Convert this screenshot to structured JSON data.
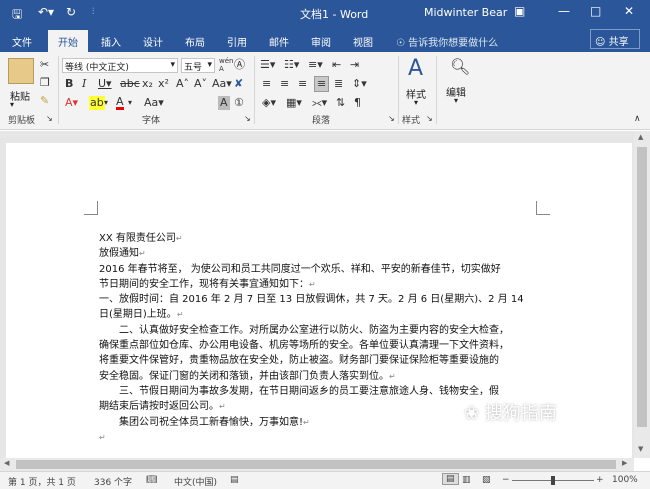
{
  "window": {
    "title": "文档1 - Word",
    "user": "Midwinter Bear"
  },
  "tabs": [
    {
      "label": "文件"
    },
    {
      "label": "开始"
    },
    {
      "label": "插入"
    },
    {
      "label": "设计"
    },
    {
      "label": "布局"
    },
    {
      "label": "引用"
    },
    {
      "label": "邮件"
    },
    {
      "label": "审阅"
    },
    {
      "label": "视图"
    }
  ],
  "tell_me": "告诉我你想要做什么",
  "share_label": "共享",
  "ribbon": {
    "paste_label": "粘贴",
    "font_name": "等线 (中文正文)",
    "font_size": "五号",
    "style_label": "样式",
    "edit_label": "编辑",
    "groups": {
      "clipboard": "剪贴板",
      "font": "字体",
      "paragraph": "段落",
      "styles": "样式"
    }
  },
  "document": {
    "lines": [
      "XX 有限责任公司",
      "放假通知",
      "2016 年春节将至， 为使公司和员工共同度过一个欢乐、祥和、平安的新春佳节，切实做好",
      "节日期间的安全工作，现将有关事宜通知如下：",
      "一、放假时间：自 2016 年 2 月 7 日至 13 日放假调休，共 7 天。2 月 6 日(星期六)、2 月 14",
      "日(星期日)上班。",
      "　　二、认真做好安全检查工作。对所属办公室进行以防火、防盗为主要内容的安全大检查，",
      "确保重点部位如仓库、办公用电设备、机房等场所的安全。各单位要认真清理一下文件资料，",
      "将重要文件保管好，贵重物品放在安全处，防止被盗。财务部门要保证保险柜等重要设施的",
      "安全稳固。保证门窗的关闭和落锁，并由该部门负责人落实到位。",
      "　　三、节假日期间为事故多发期，在节日期间返乡的员工要注意旅途人身、钱物安全，假",
      "期结束后请按时返回公司。",
      "　　集团公司祝全体员工新春愉快，万事如意!",
      ""
    ]
  },
  "status": {
    "page": "第 1 页，共 1 页",
    "words": "336 个字",
    "language": "中文(中国)",
    "zoom": "100%"
  },
  "watermark": "搜狗指南"
}
